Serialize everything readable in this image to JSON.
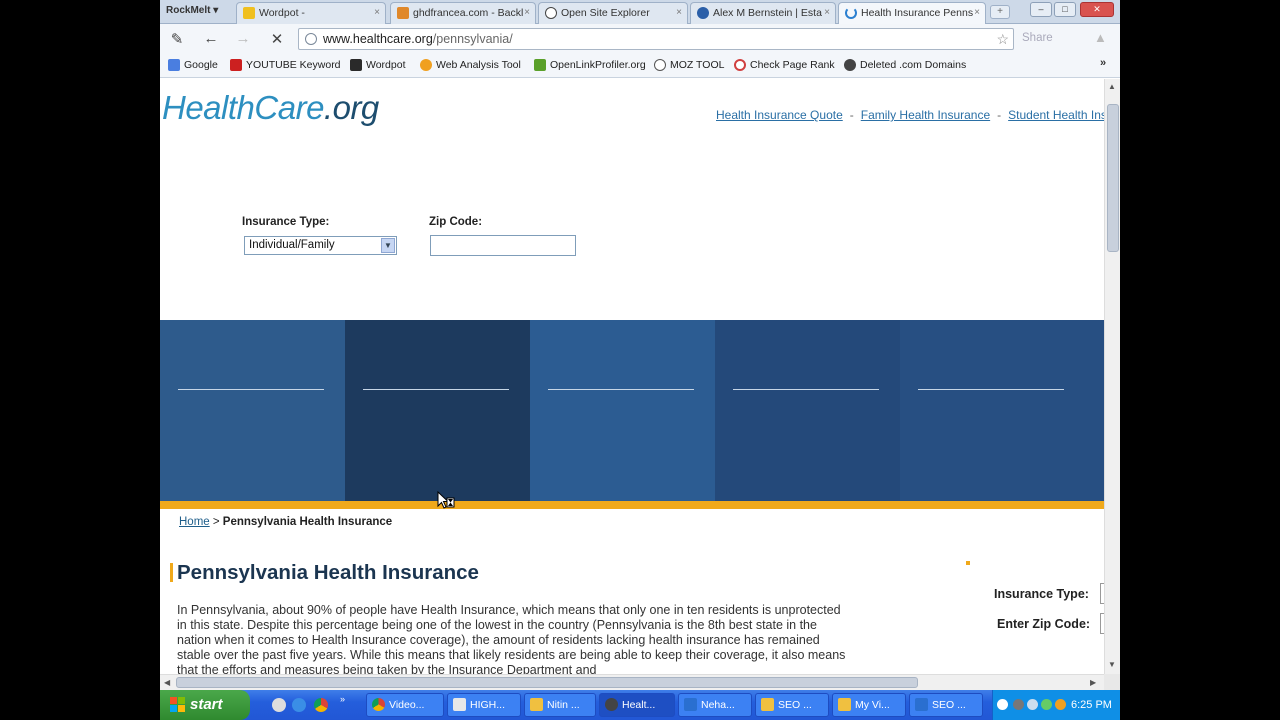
{
  "browser": {
    "brand": "RockMelt ▾",
    "tabs": [
      {
        "label": "Wordpot -",
        "close": "×",
        "color": "#2a2a2a"
      },
      {
        "label": "ghdfrancea.com - Backl",
        "close": "×",
        "color": "#e0882a"
      },
      {
        "label": "Open Site Explorer",
        "close": "×",
        "color": "#444444"
      },
      {
        "label": "Alex M Bernstein | Esta",
        "close": "×",
        "color": "#2b5fa8"
      },
      {
        "label": "Health Insurance Penns",
        "close": "×",
        "color": "#2a7fd0"
      }
    ],
    "new_tab": "+",
    "window_buttons": [
      "–",
      "□",
      "✕"
    ],
    "toolbar": {
      "compose": "✎",
      "back": "←",
      "forward": "→",
      "stop": "✕",
      "url_domain": "www.healthcare.org",
      "url_path": "/pennsylvania/",
      "star": "☆",
      "share": "Share",
      "bell": "▲"
    },
    "bookmarks": [
      {
        "label": "Google",
        "color": "#4a7ee0"
      },
      {
        "label": "YOUTUBE Keyword",
        "color": "#cc2020"
      },
      {
        "label": "Wordpot",
        "color": "#2a2a2a"
      },
      {
        "label": "Web Analysis Tool",
        "color": "#f0a020"
      },
      {
        "label": "OpenLinkProfiler.org",
        "color": "#5aa02a"
      },
      {
        "label": "MOZ TOOL",
        "color": "#555555"
      },
      {
        "label": "Check Page Rank",
        "color": "#d04040"
      },
      {
        "label": "Deleted .com Domains",
        "color": "#444444"
      }
    ],
    "bookmarks_more": "»"
  },
  "page": {
    "logo_health": "HealthCare",
    "logo_org": ".org",
    "top_links": [
      "Health Insurance Quote",
      "Family Health Insurance",
      "Student Health Insur"
    ],
    "top_link_sep": "-",
    "form": {
      "insurance_type_label": "Insurance Type:",
      "insurance_type_value": "Individual/Family",
      "zip_label": "Zip Code:",
      "zip_value": ""
    },
    "banner_colors": [
      "#2e5b8c",
      "#1d3a5e",
      "#2c5c92",
      "#24497a",
      "#274f82"
    ],
    "breadcrumb_home": "Home",
    "breadcrumb_sep": " > ",
    "breadcrumb_current": "Pennsylvania Health Insurance",
    "heading": "Pennsylvania Health Insurance",
    "paragraph": "In Pennsylvania, about 90% of people have Health Insurance, which means that only one in ten residents is unprotected in this state. Despite this percentage being one of the lowest in the country (Pennsylvania is the 8th best state in the nation when it comes to Health Insurance coverage), the amount of residents lacking health insurance has remained stable over the past five years. While this means that likely residents are being able to keep their coverage, it also means that the efforts and measures being taken by the Insurance Department and",
    "sidebar_insurance_label": "Insurance Type:",
    "sidebar_zip_label": "Enter Zip Code:"
  },
  "taskbar": {
    "start": "start",
    "buttons": [
      {
        "label": "Video...",
        "color": "#e04a2a"
      },
      {
        "label": "HIGH...",
        "color": "#e8e8e8"
      },
      {
        "label": "Nitin ...",
        "color": "#f0c040"
      },
      {
        "label": "Healt...",
        "color": "#444444"
      },
      {
        "label": "Neha...",
        "color": "#2a6fd0"
      },
      {
        "label": "SEO ...",
        "color": "#f0c040"
      },
      {
        "label": "My Vi...",
        "color": "#f0c040"
      },
      {
        "label": "SEO ...",
        "color": "#2a6fd0"
      }
    ],
    "clock": "6:25 PM"
  }
}
